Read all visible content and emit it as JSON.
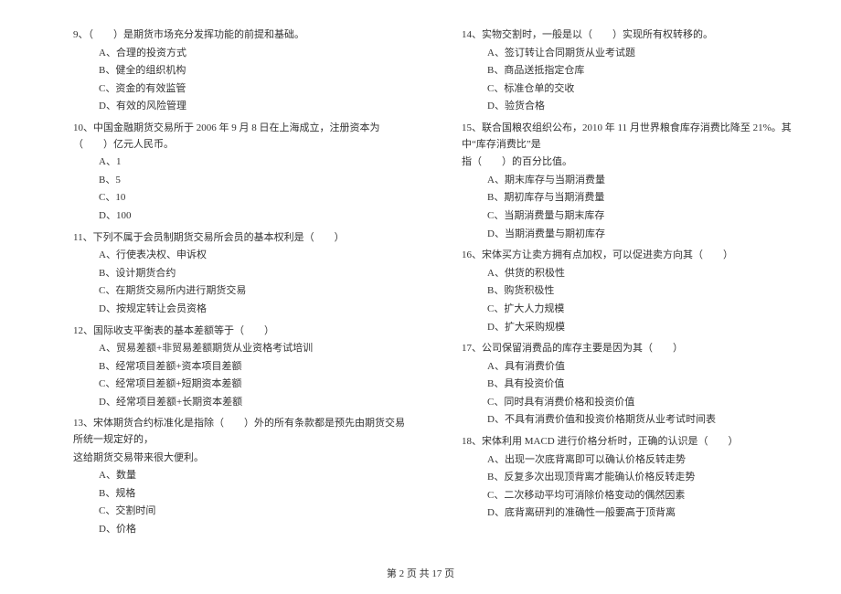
{
  "left": {
    "q9": {
      "stem": "9、（　　）是期货市场充分发挥功能的前提和基础。",
      "options": {
        "A": "A、合理的投资方式",
        "B": "B、健全的组织机构",
        "C": "C、资金的有效监管",
        "D": "D、有效的风险管理"
      }
    },
    "q10": {
      "stem": "10、中国金融期货交易所于 2006 年 9 月 8 日在上海成立，注册资本为（　　）亿元人民币。",
      "options": {
        "A": "A、1",
        "B": "B、5",
        "C": "C、10",
        "D": "D、100"
      }
    },
    "q11": {
      "stem": "11、下列不属于会员制期货交易所会员的基本权利是（　　）",
      "options": {
        "A": "A、行使表决权、申诉权",
        "B": "B、设计期货合约",
        "C": "C、在期货交易所内进行期货交易",
        "D": "D、按规定转让会员资格"
      }
    },
    "q12": {
      "stem": "12、国际收支平衡表的基本差额等于（　　）",
      "options": {
        "A": "A、贸易差额+非贸易差额期货从业资格考试培训",
        "B": "B、经常项目差额+资本项目差额",
        "C": "C、经常项目差额+短期资本差额",
        "D": "D、经常项目差额+长期资本差额"
      }
    },
    "q13": {
      "stem": "13、宋体期货合约标准化是指除（　　）外的所有条款都是预先由期货交易所统一规定好的，",
      "cont": "这给期货交易带来很大便利。",
      "options": {
        "A": "A、数量",
        "B": "B、规格",
        "C": "C、交割时间",
        "D": "D、价格"
      }
    }
  },
  "right": {
    "q14": {
      "stem": "14、实物交割时，一般是以（　　）实现所有权转移的。",
      "options": {
        "A": "A、签订转让合同期货从业考试题",
        "B": "B、商品送抵指定仓库",
        "C": "C、标准仓单的交收",
        "D": "D、验货合格"
      }
    },
    "q15": {
      "stem": "15、联合国粮农组织公布，2010 年 11 月世界粮食库存消费比降至 21%。其中“库存消费比”是",
      "cont": "指（　　）的百分比值。",
      "options": {
        "A": "A、期末库存与当期消费量",
        "B": "B、期初库存与当期消费量",
        "C": "C、当期消费量与期末库存",
        "D": "D、当期消费量与期初库存"
      }
    },
    "q16": {
      "stem": "16、宋体买方让卖方拥有点加权，可以促进卖方向其（　　）",
      "options": {
        "A": "A、供货的积极性",
        "B": "B、购货积极性",
        "C": "C、扩大人力规模",
        "D": "D、扩大采购规模"
      }
    },
    "q17": {
      "stem": "17、公司保留消费品的库存主要是因为其（　　）",
      "options": {
        "A": "A、具有消费价值",
        "B": "B、具有投资价值",
        "C": "C、同时具有消费价格和投资价值",
        "D": "D、不具有消费价值和投资价格期货从业考试时间表"
      }
    },
    "q18": {
      "stem": "18、宋体利用 MACD 进行价格分析时，正确的认识是（　　）",
      "options": {
        "A": "A、出现一次底背离即可以确认价格反转走势",
        "B": "B、反复多次出现顶背离才能确认价格反转走势",
        "C": "C、二次移动平均可消除价格变动的偶然因素",
        "D": "D、底背离研判的准确性一般要高于顶背离"
      }
    }
  },
  "footer": "第 2 页 共 17 页"
}
